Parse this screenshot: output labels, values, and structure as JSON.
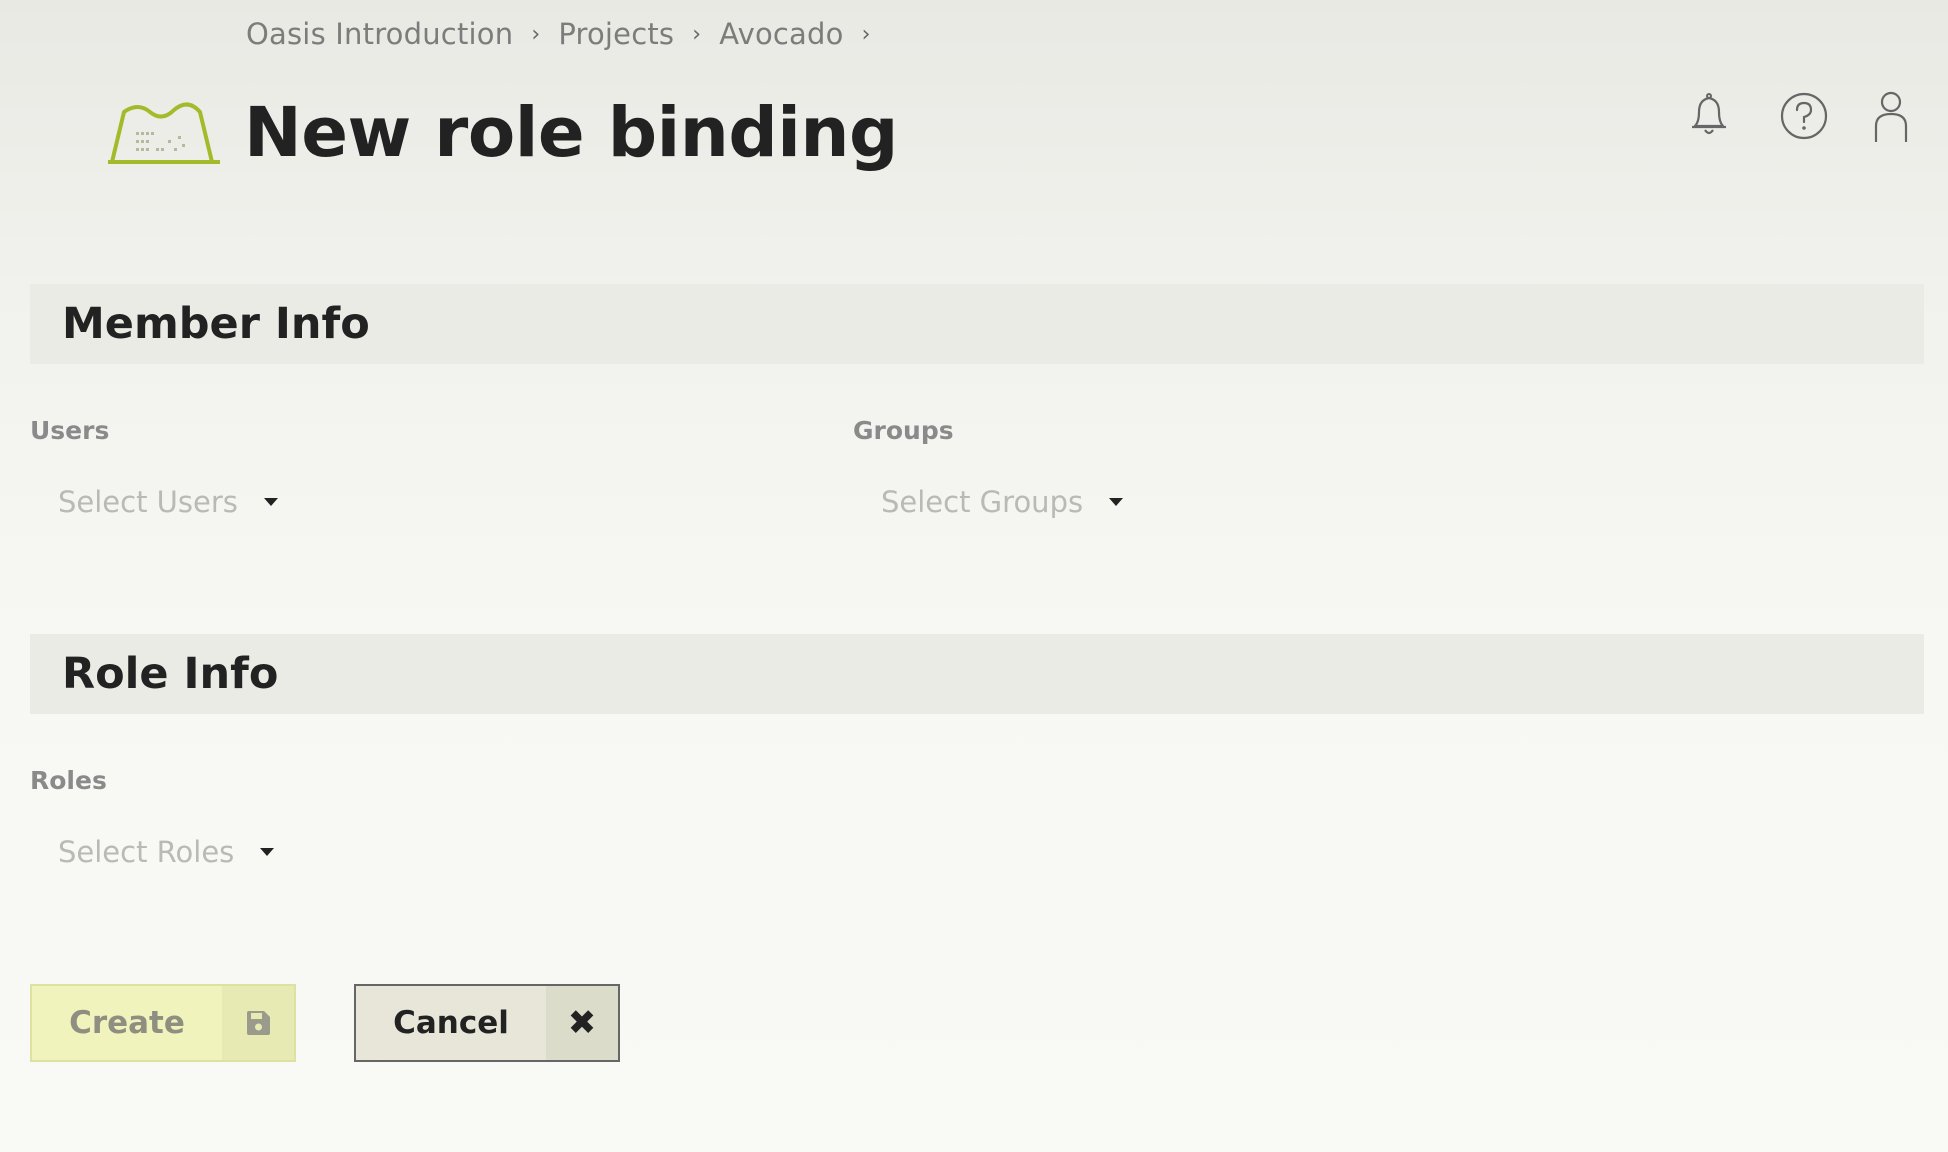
{
  "breadcrumb": {
    "items": [
      "Oasis Introduction",
      "Projects",
      "Avocado"
    ],
    "separator": "›"
  },
  "header": {
    "title": "New role binding",
    "logo_icon": "hat-logo-icon",
    "icons": [
      "bell-icon",
      "help-icon",
      "user-icon"
    ]
  },
  "member_info": {
    "title": "Member Info",
    "users": {
      "label": "Users",
      "placeholder": "Select Users"
    },
    "groups": {
      "label": "Groups",
      "placeholder": "Select Groups"
    }
  },
  "role_info": {
    "title": "Role Info",
    "roles": {
      "label": "Roles",
      "placeholder": "Select Roles"
    }
  },
  "actions": {
    "create_label": "Create",
    "create_icon": "save-icon",
    "cancel_label": "Cancel",
    "cancel_icon": "close-icon",
    "cancel_glyph": "✖"
  },
  "colors": {
    "accent": "#a3bb2a",
    "create_bg": "#f1f3bd",
    "cancel_bg": "#e7e6d8",
    "section_bg": "#ebebe6"
  }
}
